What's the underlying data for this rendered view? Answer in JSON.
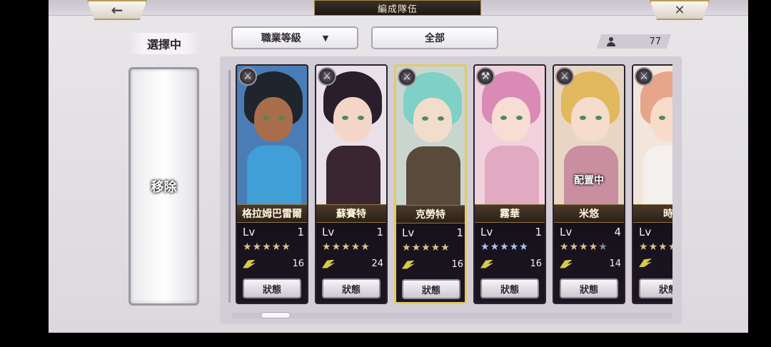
{
  "header": {
    "title": "編成隊伍",
    "back_icon": "←",
    "close_icon": "✕"
  },
  "left_panel": {
    "selecting_label": "選擇中",
    "remove_label": "移除"
  },
  "filters": {
    "job_level_label": "職業等級",
    "dropdown_arrow": "▼",
    "all_label": "全部"
  },
  "unit_count": "77",
  "cards": [
    {
      "name": "格拉姆巴雷爾",
      "lv_label": "Lv",
      "level": "1",
      "cost": "16",
      "status_label": "狀態",
      "class_icon": "⚔",
      "stars": [
        "gold",
        "gold",
        "gold",
        "gold",
        "gold"
      ],
      "deployed": "",
      "selected": false,
      "colors": {
        "bg": "#4a7db6",
        "hair": "#20242c",
        "skin": "#a86d4a",
        "body": "#3f9fd6"
      }
    },
    {
      "name": "蘇賽特",
      "lv_label": "Lv",
      "level": "1",
      "cost": "24",
      "status_label": "狀態",
      "class_icon": "⚔",
      "stars": [
        "gold",
        "gold",
        "gold",
        "gold",
        "gold"
      ],
      "deployed": "",
      "selected": false,
      "colors": {
        "bg": "#e9e1e7",
        "hair": "#2a1e2b",
        "skin": "#f4d6c8",
        "body": "#3a2630"
      }
    },
    {
      "name": "克勞特",
      "lv_label": "Lv",
      "level": "1",
      "cost": "16",
      "status_label": "狀態",
      "class_icon": "⚔",
      "stars": [
        "gold",
        "gold",
        "gold",
        "gold",
        "gold"
      ],
      "deployed": "",
      "selected": true,
      "colors": {
        "bg": "#c9d6cf",
        "hair": "#7fd0c7",
        "skin": "#f2dccb",
        "body": "#5a4a3c"
      }
    },
    {
      "name": "霧華",
      "lv_label": "Lv",
      "level": "1",
      "cost": "16",
      "status_label": "狀態",
      "class_icon": "⚒",
      "stars": [
        "blue",
        "blue",
        "blue",
        "blue",
        "blue"
      ],
      "deployed": "",
      "selected": false,
      "colors": {
        "bg": "#f1d2dc",
        "hair": "#d98bb6",
        "skin": "#f7ddd3",
        "body": "#e2a9c2"
      }
    },
    {
      "name": "米悠",
      "lv_label": "Lv",
      "level": "4",
      "cost": "14",
      "status_label": "狀態",
      "class_icon": "⚔",
      "stars": [
        "gold",
        "gold",
        "gold",
        "gold",
        "gray"
      ],
      "deployed": "配置中",
      "selected": false,
      "colors": {
        "bg": "#e8d6c4",
        "hair": "#e2b85e",
        "skin": "#f6dccc",
        "body": "#c98e9f"
      }
    },
    {
      "name": "時",
      "lv_label": "Lv",
      "level": "",
      "cost": "",
      "status_label": "狀態",
      "class_icon": "⚔",
      "stars": [
        "gold",
        "gold",
        "gold",
        "gold",
        "gold"
      ],
      "deployed": "",
      "selected": false,
      "colors": {
        "bg": "#f2e6dc",
        "hair": "#e7a58a",
        "skin": "#f7dcc9",
        "body": "#f3f0ee"
      }
    }
  ],
  "star_glyph": "★"
}
